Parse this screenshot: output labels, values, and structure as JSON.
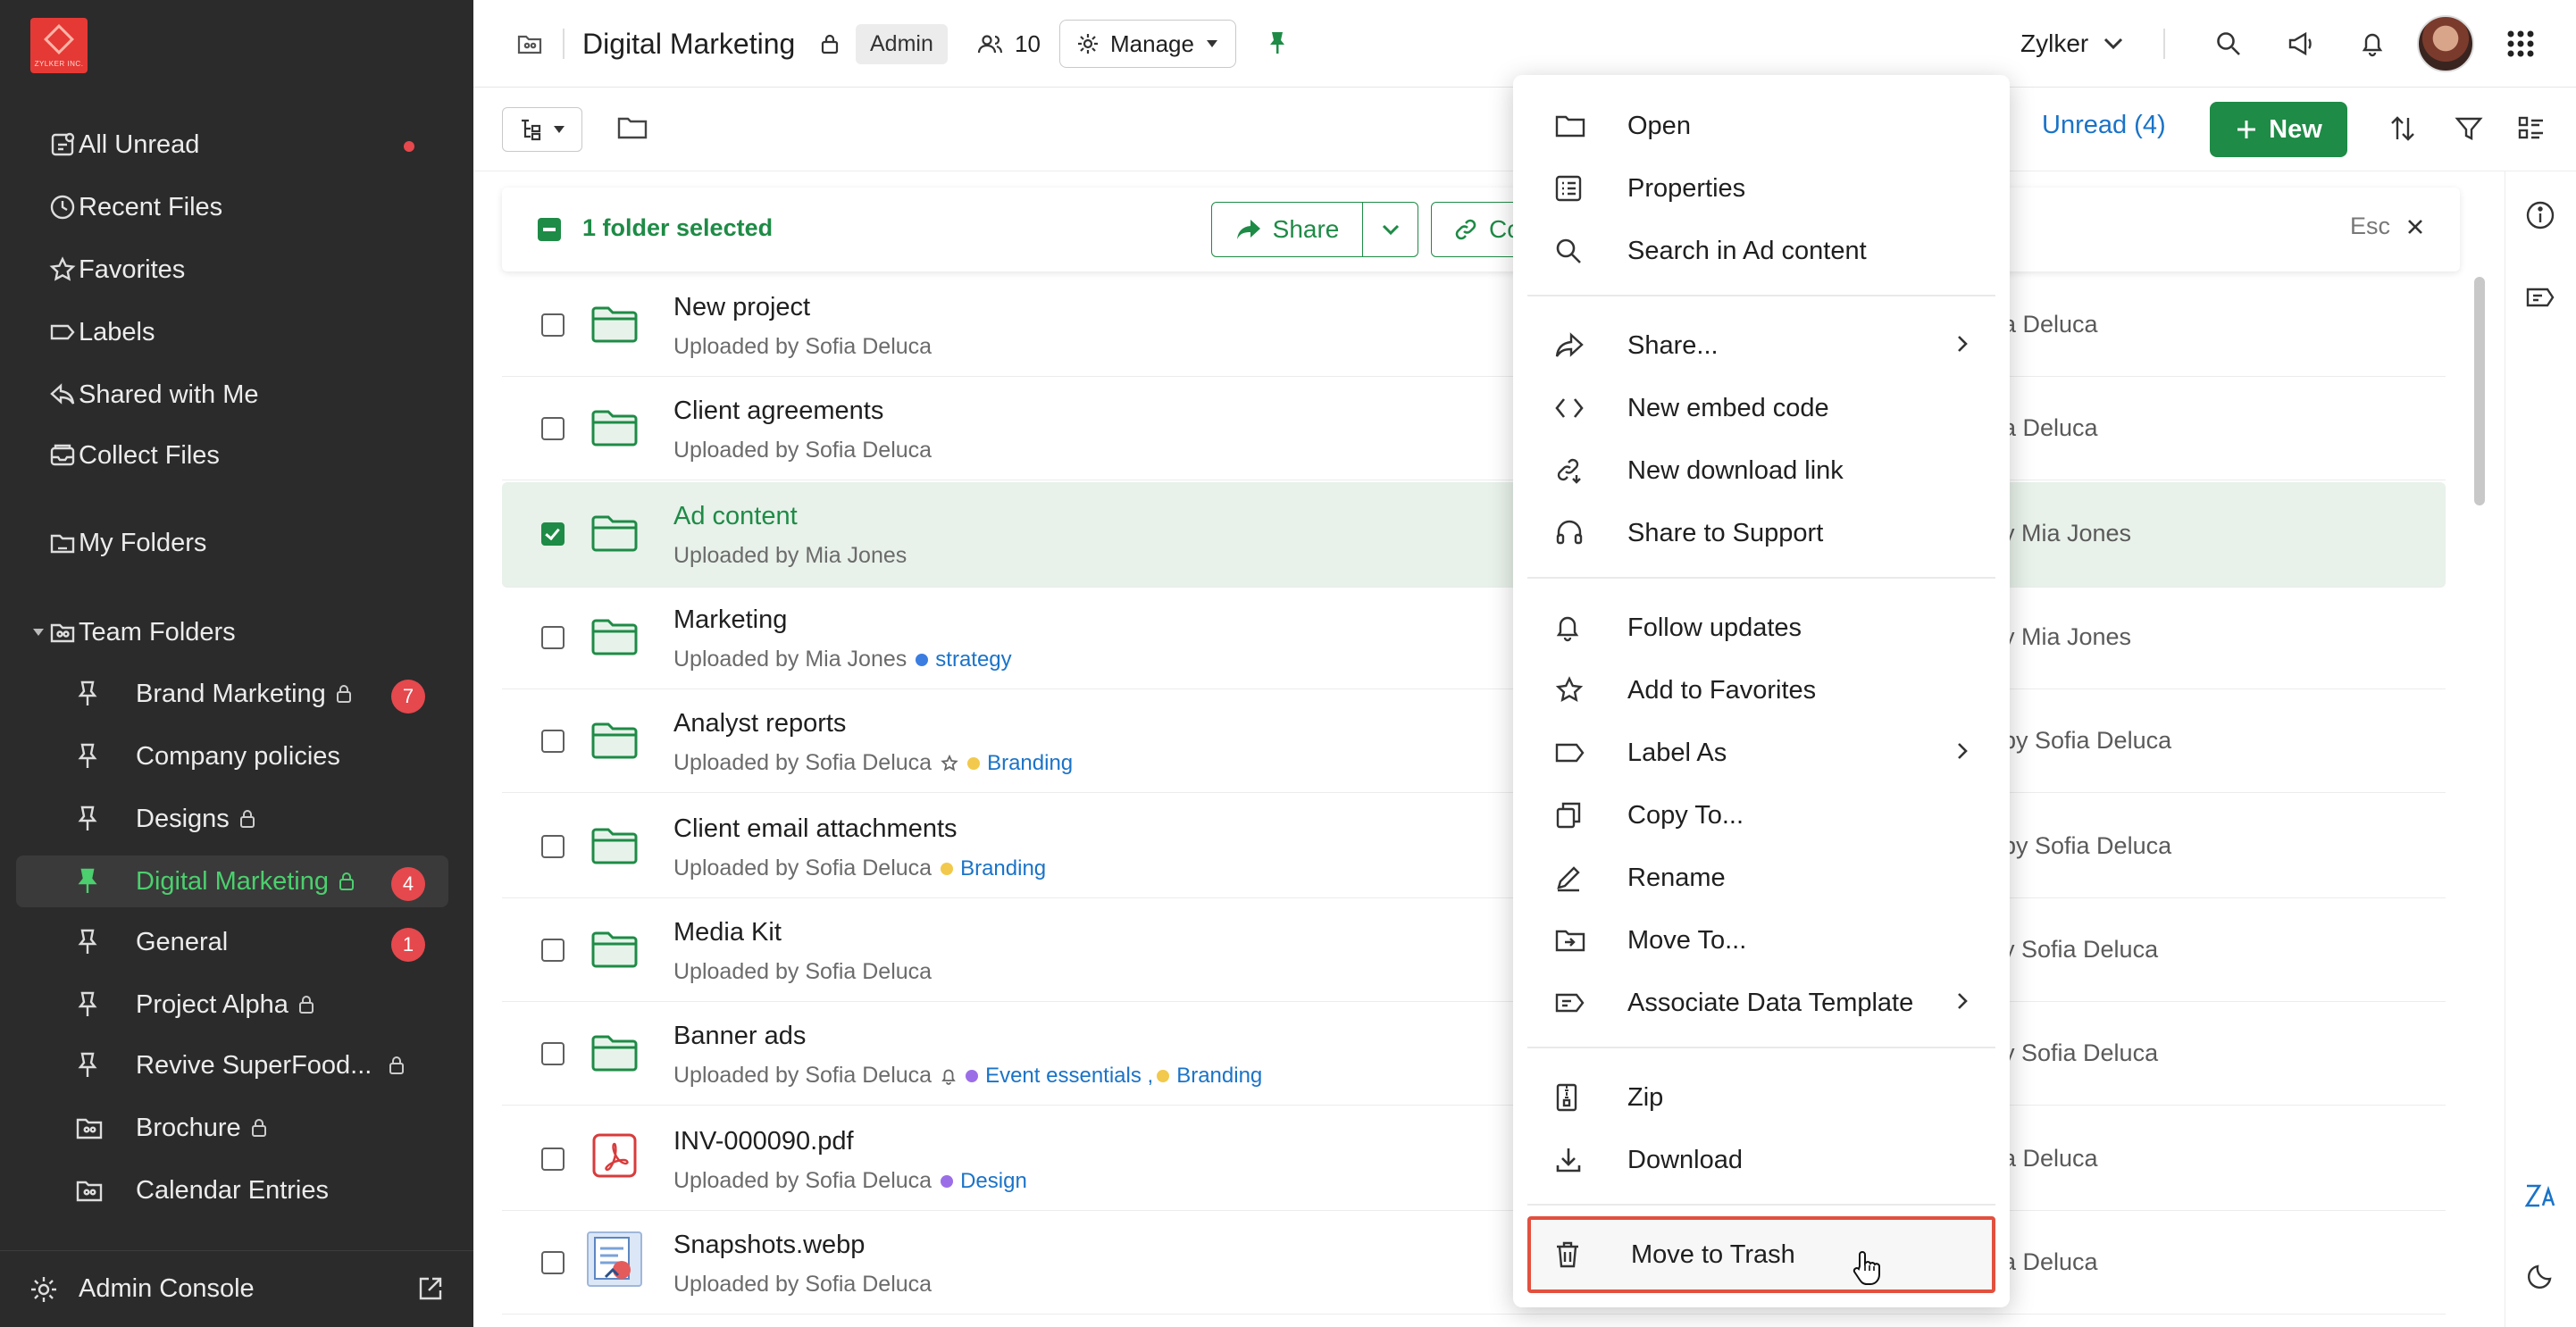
{
  "sidebar": {
    "logo_text": "ZYLKER INC.",
    "items": [
      {
        "label": "All Unread",
        "icon": "unread-icon"
      },
      {
        "label": "Recent Files",
        "icon": "clock-icon"
      },
      {
        "label": "Favorites",
        "icon": "star-icon"
      },
      {
        "label": "Labels",
        "icon": "label-icon"
      },
      {
        "label": "Shared with Me",
        "icon": "share-back-icon"
      },
      {
        "label": "Collect Files",
        "icon": "inbox-icon"
      },
      {
        "label": "My Folders",
        "icon": "folder-icon"
      }
    ],
    "team_folders_label": "Team Folders",
    "team_items": [
      {
        "label": "Brand Marketing",
        "badge": "7"
      },
      {
        "label": "Company policies",
        "badge": ""
      },
      {
        "label": "Designs",
        "badge": ""
      },
      {
        "label": "Digital Marketing",
        "badge": "4"
      },
      {
        "label": "General",
        "badge": "1"
      },
      {
        "label": "Project Alpha",
        "badge": ""
      },
      {
        "label": "Revive SuperFood...",
        "badge": ""
      },
      {
        "label": "Brochure",
        "badge": ""
      },
      {
        "label": "Calendar Entries",
        "badge": ""
      }
    ],
    "admin_console": "Admin Console"
  },
  "header": {
    "title": "Digital Marketing",
    "role_chip": "Admin",
    "member_count": "10",
    "manage_label": "Manage",
    "org_name": "Zylker"
  },
  "toolbar": {
    "unread_label": "Unread (4)",
    "new_label": "New"
  },
  "selection": {
    "text": "1 folder selected",
    "share_label": "Share",
    "copy_label": "Copy",
    "esc_label": "Esc"
  },
  "rows": [
    {
      "name": "New project",
      "sub": "Uploaded by Sofia Deluca",
      "owner": "a Deluca",
      "type": "folder"
    },
    {
      "name": "Client agreements",
      "sub": "Uploaded by Sofia Deluca",
      "owner": "a Deluca",
      "type": "folder"
    },
    {
      "name": "Ad content",
      "sub": "Uploaded by Mia Jones",
      "owner": "y Mia Jones",
      "type": "folder"
    },
    {
      "name": "Marketing",
      "sub": "Uploaded by Mia Jones",
      "owner": "y Mia Jones",
      "type": "folder",
      "tag1": "strategy"
    },
    {
      "name": "Analyst reports",
      "sub": "Uploaded by Sofia Deluca",
      "owner": "by Sofia Deluca",
      "type": "folder",
      "tag1": "Branding"
    },
    {
      "name": "Client email attachments",
      "sub": "Uploaded by Sofia Deluca",
      "owner": "by Sofia Deluca",
      "type": "folder",
      "tag1": "Branding"
    },
    {
      "name": "Media Kit",
      "sub": "Uploaded by Sofia Deluca",
      "owner": "y Sofia Deluca",
      "type": "folder"
    },
    {
      "name": "Banner ads",
      "sub": "Uploaded by Sofia Deluca",
      "owner": "y Sofia Deluca",
      "type": "folder",
      "tag1": "Event essentials ,",
      "tag2": "Branding"
    },
    {
      "name": "INV-000090.pdf",
      "sub": "Uploaded by Sofia Deluca",
      "owner": "a Deluca",
      "type": "pdf",
      "tag1": "Design"
    },
    {
      "name": "Snapshots.webp",
      "sub": "Uploaded by Sofia Deluca",
      "owner": "a Deluca",
      "type": "image"
    }
  ],
  "tag_colors": {
    "strategy": "#3b7de0",
    "Branding": "#f2c94c",
    "Design": "#9b6ee8",
    "Event essentials": "#9b6ee8"
  },
  "menu": {
    "open": "Open",
    "properties": "Properties",
    "search": "Search in Ad content",
    "share": "Share...",
    "embed": "New embed code",
    "download_link": "New download link",
    "share_support": "Share to Support",
    "follow": "Follow updates",
    "favorites": "Add to Favorites",
    "label_as": "Label As",
    "copy_to": "Copy To...",
    "rename": "Rename",
    "move_to": "Move To...",
    "associate": "Associate Data Template",
    "zip": "Zip",
    "download": "Download",
    "trash": "Move to Trash"
  },
  "colors": {
    "accent": "#1e8b46",
    "link": "#1a73c8",
    "badge": "#e5484d",
    "highlight_border": "#e2503e"
  }
}
